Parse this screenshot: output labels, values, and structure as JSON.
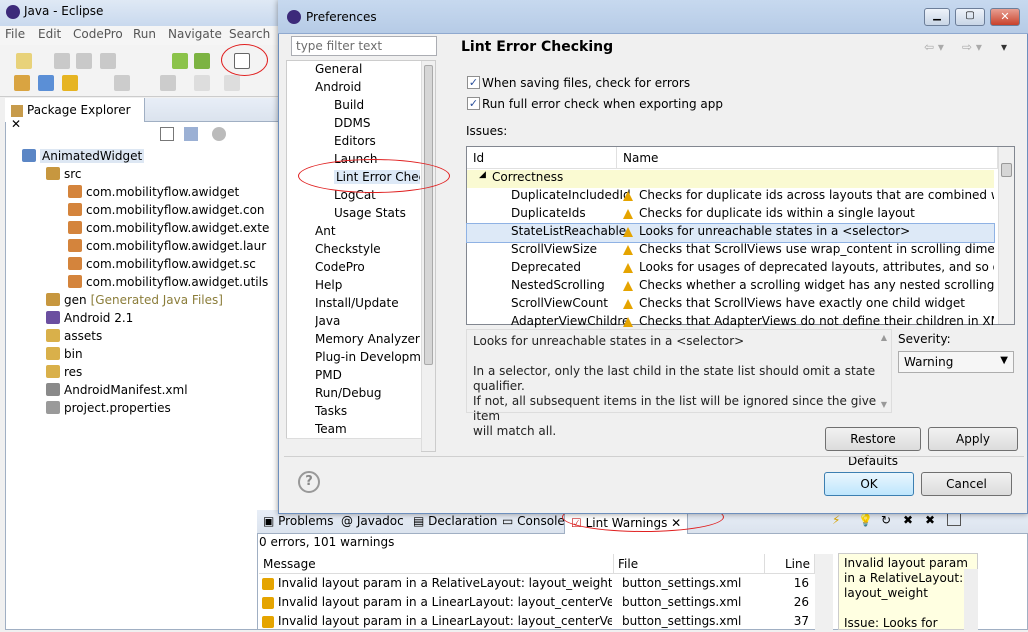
{
  "eclipse": {
    "title": "Java - Eclipse",
    "menu": [
      "File",
      "Edit",
      "CodePro",
      "Run",
      "Navigate",
      "Search"
    ]
  },
  "package_explorer": {
    "tab": "Package Explorer",
    "tree": [
      {
        "label": "AnimatedWidget",
        "indent": 0
      },
      {
        "label": "src",
        "indent": 1
      },
      {
        "label": "com.mobilityflow.awidget",
        "indent": 2
      },
      {
        "label": "com.mobilityflow.awidget.con",
        "indent": 2
      },
      {
        "label": "com.mobilityflow.awidget.exte",
        "indent": 2
      },
      {
        "label": "com.mobilityflow.awidget.laur",
        "indent": 2
      },
      {
        "label": "com.mobilityflow.awidget.sc",
        "indent": 2
      },
      {
        "label": "com.mobilityflow.awidget.utils",
        "indent": 2
      },
      {
        "label": "gen",
        "suffix": "[Generated Java Files]",
        "indent": 1
      },
      {
        "label": "Android 2.1",
        "indent": 1
      },
      {
        "label": "assets",
        "indent": 1
      },
      {
        "label": "bin",
        "indent": 1
      },
      {
        "label": "res",
        "indent": 1
      },
      {
        "label": "AndroidManifest.xml",
        "indent": 1
      },
      {
        "label": "project.properties",
        "indent": 1
      }
    ]
  },
  "dialog": {
    "title": "Preferences",
    "filter_placeholder": "type filter text",
    "page_title": "Lint Error Checking",
    "nav": [
      {
        "label": "General",
        "indent": 0
      },
      {
        "label": "Android",
        "indent": 0
      },
      {
        "label": "Build",
        "indent": 1
      },
      {
        "label": "DDMS",
        "indent": 1
      },
      {
        "label": "Editors",
        "indent": 1
      },
      {
        "label": "Launch",
        "indent": 1
      },
      {
        "label": "Lint Error Checki",
        "indent": 1,
        "selected": true
      },
      {
        "label": "LogCat",
        "indent": 1
      },
      {
        "label": "Usage Stats",
        "indent": 1
      },
      {
        "label": "Ant",
        "indent": 0
      },
      {
        "label": "Checkstyle",
        "indent": 0
      },
      {
        "label": "CodePro",
        "indent": 0
      },
      {
        "label": "Help",
        "indent": 0
      },
      {
        "label": "Install/Update",
        "indent": 0
      },
      {
        "label": "Java",
        "indent": 0
      },
      {
        "label": "Memory Analyzer",
        "indent": 0
      },
      {
        "label": "Plug-in Developmen",
        "indent": 0
      },
      {
        "label": "PMD",
        "indent": 0
      },
      {
        "label": "Run/Debug",
        "indent": 0
      },
      {
        "label": "Tasks",
        "indent": 0
      },
      {
        "label": "Team",
        "indent": 0
      }
    ],
    "check1": "When saving files, check for errors",
    "check2": "Run full error check when exporting app",
    "issues_label": "Issues:",
    "col_id": "Id",
    "col_name": "Name",
    "category": "Correctness",
    "issues": [
      {
        "id": "DuplicateIncludedId",
        "name": "Checks for duplicate ids across layouts that are combined with in..."
      },
      {
        "id": "DuplicateIds",
        "name": "Checks for duplicate ids within a single layout"
      },
      {
        "id": "StateListReachable",
        "name": "Looks for unreachable states in a <selector>",
        "selected": true
      },
      {
        "id": "ScrollViewSize",
        "name": "Checks that ScrollViews use wrap_content in scrolling dimension"
      },
      {
        "id": "Deprecated",
        "name": "Looks for usages of deprecated layouts, attributes, and so on."
      },
      {
        "id": "NestedScrolling",
        "name": "Checks whether a scrolling widget has any nested scrolling widge..."
      },
      {
        "id": "ScrollViewCount",
        "name": "Checks that ScrollViews have exactly one child widget"
      },
      {
        "id": "AdapterViewChildre",
        "name": "Checks that AdapterViews do not define their children in XML"
      }
    ],
    "desc_line1": "Looks for unreachable states in a <selector>",
    "desc_line2": "In a selector, only the last child in the state list should omit a state qualifier.",
    "desc_line3": "If not, all subsequent items in the list will be ignored since the given item",
    "desc_line4": "will match all.",
    "severity_label": "Severity:",
    "severity_value": "Warning",
    "restore": "Restore Defaults",
    "apply": "Apply",
    "ok": "OK",
    "cancel": "Cancel"
  },
  "bottom": {
    "tabs": [
      "Problems",
      "Javadoc",
      "Declaration",
      "Console",
      "Lint Warnings"
    ],
    "summary": "0 errors, 101 warnings",
    "col_message": "Message",
    "col_file": "File",
    "col_line": "Line",
    "rows": [
      {
        "message": "Invalid layout param in a RelativeLayout: layout_weight",
        "file": "button_settings.xml",
        "line": "16"
      },
      {
        "message": "Invalid layout param in a LinearLayout: layout_centerVertical",
        "file": "button_settings.xml",
        "line": "26"
      },
      {
        "message": "Invalid layout param in a LinearLayout: layout_centerVertical",
        "file": "button_settings.xml",
        "line": "37"
      }
    ],
    "side_desc": [
      "Invalid layout param",
      "in a RelativeLayout:",
      "layout_weight",
      "",
      "Issue: Looks for"
    ]
  }
}
